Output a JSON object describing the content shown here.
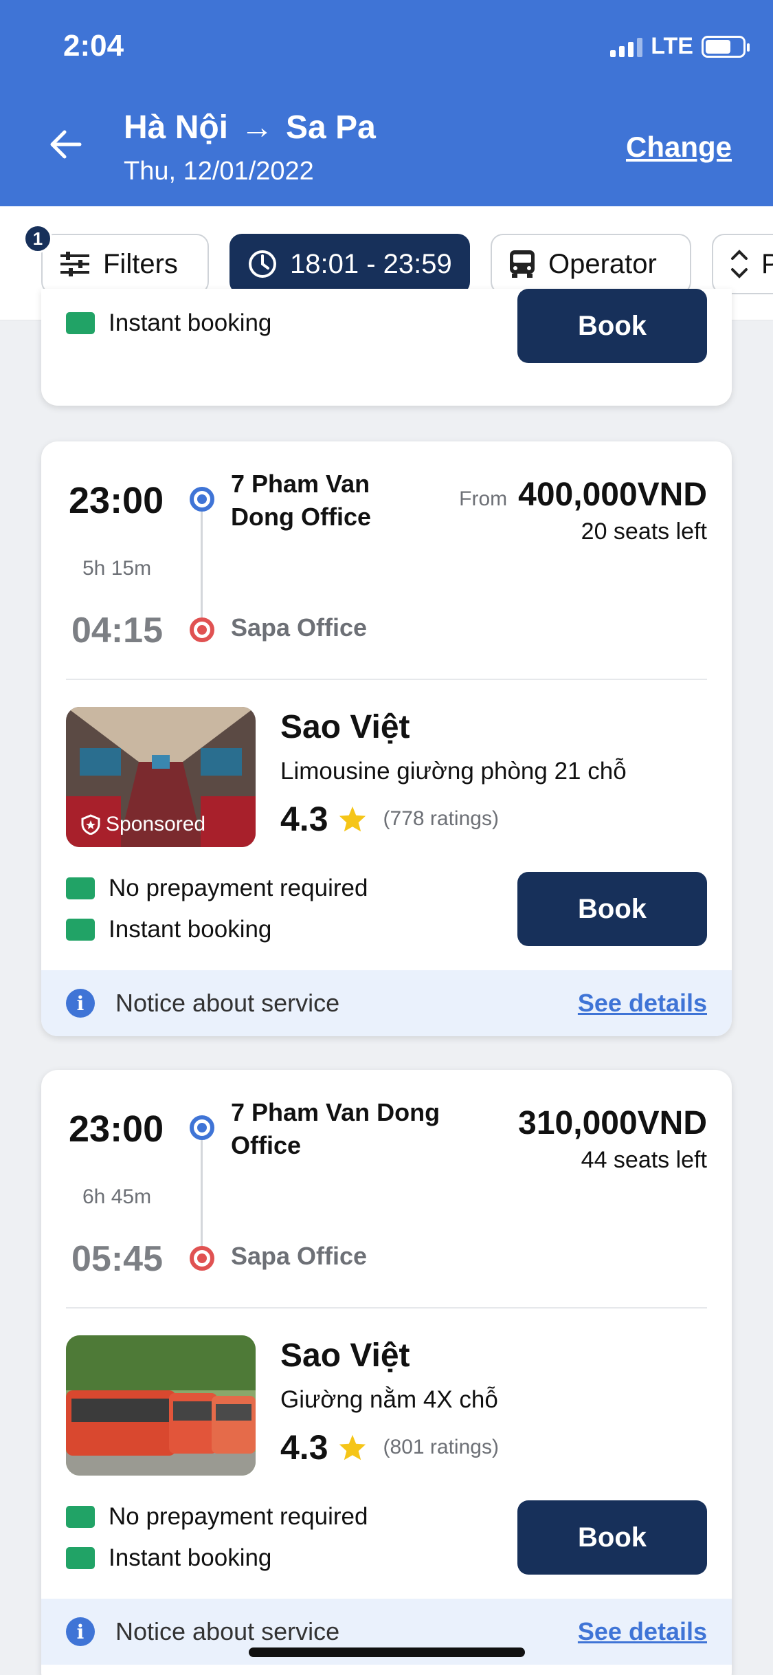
{
  "status_bar": {
    "time": "2:04",
    "network": "LTE"
  },
  "header": {
    "origin": "Hà Nội",
    "arrow": "→",
    "destination": "Sa Pa",
    "date": "Thu, 12/01/2022",
    "change_label": "Change"
  },
  "filters": {
    "badge_count": "1",
    "filters_label": "Filters",
    "time_range_label": "18:01 - 23:59",
    "operator_label": "Operator",
    "sort_label": "P"
  },
  "partial_card": {
    "feature": "Instant booking",
    "book_label": "Book"
  },
  "trips": [
    {
      "departure_time": "23:00",
      "arrival_time": "04:15",
      "duration": "5h 15m",
      "from_stop": "7 Pham Van Dong Office",
      "to_stop": "Sapa Office",
      "from_label": "From",
      "price": "400,000VND",
      "seats_left": "20 seats left",
      "operator": "Sao Việt",
      "vehicle_type": "Limousine giường phòng 21 chỗ",
      "rating": "4.3",
      "rating_count": "(778 ratings)",
      "sponsored_label": "Sponsored",
      "feature_1": "No prepayment required",
      "feature_2": "Instant booking",
      "book_label": "Book",
      "notice": "Notice about service",
      "see_details": "See details"
    },
    {
      "departure_time": "23:00",
      "arrival_time": "05:45",
      "duration": "6h 45m",
      "from_stop": "7 Pham Van Dong Office",
      "to_stop": "Sapa Office",
      "price": "310,000VND",
      "seats_left": "44 seats left",
      "operator": "Sao Việt",
      "vehicle_type": "Giường nằm 4X chỗ",
      "rating": "4.3",
      "rating_count": "(801 ratings)",
      "feature_1": "No prepayment required",
      "feature_2": "Instant booking",
      "book_label": "Book",
      "notice": "Notice about service",
      "see_details": "See details"
    }
  ],
  "colors": {
    "header_blue": "#3f74d6",
    "navy": "#17305a",
    "origin_dot": "#3f74d6",
    "destination_dot": "#e05252",
    "feature_green": "#21a366",
    "star": "#f5c518"
  }
}
